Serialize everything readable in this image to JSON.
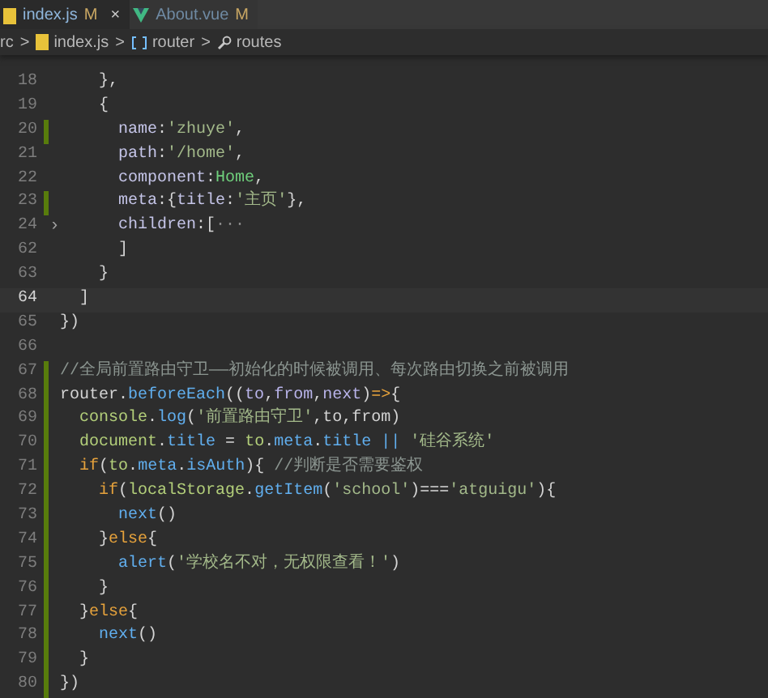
{
  "tabs": [
    {
      "kind": "js",
      "label": "index.js",
      "status": "M",
      "close": "×",
      "selected": true
    },
    {
      "kind": "vue",
      "label": "About.vue",
      "status": "M",
      "selected": false
    }
  ],
  "breadcrumb": [
    {
      "kind": "folder",
      "label": "rc"
    },
    {
      "kind": "js",
      "label": "index.js"
    },
    {
      "kind": "variable",
      "label": "router"
    },
    {
      "kind": "property",
      "label": "routes"
    }
  ],
  "breadcrumb_separator": ">",
  "lines": [
    {
      "n": "18",
      "current": false,
      "modified": false,
      "tokens": [
        {
          "kind": "plain",
          "t": "    },"
        }
      ]
    },
    {
      "n": "19",
      "current": false,
      "modified": false,
      "tokens": [
        {
          "kind": "plain",
          "t": "    {"
        }
      ]
    },
    {
      "n": "20",
      "current": false,
      "modified": true,
      "tokens": [
        {
          "kind": "prop",
          "t": "      name"
        },
        {
          "kind": "plain",
          "t": ":"
        },
        {
          "kind": "string",
          "t": "'zhuye'"
        },
        {
          "kind": "plain",
          "t": ","
        }
      ]
    },
    {
      "n": "21",
      "current": false,
      "modified": false,
      "tokens": [
        {
          "kind": "prop",
          "t": "      path"
        },
        {
          "kind": "plain",
          "t": ":"
        },
        {
          "kind": "string",
          "t": "'/home'"
        },
        {
          "kind": "plain",
          "t": ","
        }
      ]
    },
    {
      "n": "22",
      "current": false,
      "modified": false,
      "tokens": [
        {
          "kind": "prop",
          "t": "      component"
        },
        {
          "kind": "plain",
          "t": ":"
        },
        {
          "kind": "class",
          "t": "Home"
        },
        {
          "kind": "plain",
          "t": ","
        }
      ]
    },
    {
      "n": "23",
      "current": false,
      "modified": true,
      "tokens": [
        {
          "kind": "prop",
          "t": "      meta"
        },
        {
          "kind": "plain",
          "t": ":{"
        },
        {
          "kind": "prop",
          "t": "title"
        },
        {
          "kind": "plain",
          "t": ":"
        },
        {
          "kind": "string",
          "t": "'主页'"
        },
        {
          "kind": "plain",
          "t": "},"
        }
      ]
    },
    {
      "n": "24",
      "current": false,
      "modified": false,
      "fold": "›",
      "tokens": [
        {
          "kind": "prop",
          "t": "      children"
        },
        {
          "kind": "plain",
          "t": ":["
        },
        {
          "kind": "folded",
          "t": "···"
        }
      ]
    },
    {
      "n": "62",
      "current": false,
      "modified": false,
      "tokens": [
        {
          "kind": "plain",
          "t": "      ]"
        }
      ]
    },
    {
      "n": "63",
      "current": false,
      "modified": false,
      "tokens": [
        {
          "kind": "plain",
          "t": "    }"
        }
      ]
    },
    {
      "n": "64",
      "current": true,
      "modified": false,
      "tokens": [
        {
          "kind": "plain",
          "t": "  ]"
        }
      ]
    },
    {
      "n": "65",
      "current": false,
      "modified": false,
      "tokens": [
        {
          "kind": "plain",
          "t": "})"
        }
      ]
    },
    {
      "n": "66",
      "current": false,
      "modified": false
    },
    {
      "n": "67",
      "current": false,
      "modified": true,
      "tokens": [
        {
          "kind": "comment",
          "t": "//全局前置路由守卫——初始化的时候被调用、每次路由切换之前被调用"
        }
      ]
    },
    {
      "n": "68",
      "current": false,
      "modified": true,
      "tokens": [
        {
          "kind": "plain",
          "t": "router."
        },
        {
          "kind": "func",
          "t": "beforeEach"
        },
        {
          "kind": "plain",
          "t": "(("
        },
        {
          "kind": "param",
          "t": "to"
        },
        {
          "kind": "plain",
          "t": ","
        },
        {
          "kind": "param",
          "t": "from"
        },
        {
          "kind": "plain",
          "t": ","
        },
        {
          "kind": "param",
          "t": "next"
        },
        {
          "kind": "plain",
          "t": ")"
        },
        {
          "kind": "keyword",
          "t": "=>"
        },
        {
          "kind": "plain",
          "t": "{"
        }
      ]
    },
    {
      "n": "69",
      "current": false,
      "modified": true,
      "tokens": [
        {
          "kind": "object",
          "t": "  console"
        },
        {
          "kind": "plain",
          "t": "."
        },
        {
          "kind": "func",
          "t": "log"
        },
        {
          "kind": "plain",
          "t": "("
        },
        {
          "kind": "string",
          "t": "'前置路由守卫'"
        },
        {
          "kind": "plain",
          "t": ",to,from)"
        }
      ]
    },
    {
      "n": "70",
      "current": false,
      "modified": true,
      "tokens": [
        {
          "kind": "object",
          "t": "  document"
        },
        {
          "kind": "plain",
          "t": "."
        },
        {
          "kind": "func",
          "t": "title"
        },
        {
          "kind": "plain",
          "t": " = "
        },
        {
          "kind": "object",
          "t": "to"
        },
        {
          "kind": "plain",
          "t": "."
        },
        {
          "kind": "func",
          "t": "meta"
        },
        {
          "kind": "plain",
          "t": "."
        },
        {
          "kind": "func",
          "t": "title"
        },
        {
          "kind": "func",
          "t": " || "
        },
        {
          "kind": "string",
          "t": "'硅谷系统'"
        }
      ]
    },
    {
      "n": "71",
      "current": false,
      "modified": true,
      "tokens": [
        {
          "kind": "keyword",
          "t": "  if"
        },
        {
          "kind": "plain",
          "t": "("
        },
        {
          "kind": "object",
          "t": "to"
        },
        {
          "kind": "plain",
          "t": "."
        },
        {
          "kind": "func",
          "t": "meta"
        },
        {
          "kind": "plain",
          "t": "."
        },
        {
          "kind": "func",
          "t": "isAuth"
        },
        {
          "kind": "plain",
          "t": "){ "
        },
        {
          "kind": "comment",
          "t": "//判断是否需要鉴权"
        }
      ]
    },
    {
      "n": "72",
      "current": false,
      "modified": true,
      "tokens": [
        {
          "kind": "keyword",
          "t": "    if"
        },
        {
          "kind": "plain",
          "t": "("
        },
        {
          "kind": "object",
          "t": "localStorage"
        },
        {
          "kind": "plain",
          "t": "."
        },
        {
          "kind": "func",
          "t": "getItem"
        },
        {
          "kind": "plain",
          "t": "("
        },
        {
          "kind": "string",
          "t": "'school'"
        },
        {
          "kind": "plain",
          "t": ")==="
        },
        {
          "kind": "string",
          "t": "'atguigu'"
        },
        {
          "kind": "plain",
          "t": "){"
        }
      ]
    },
    {
      "n": "73",
      "current": false,
      "modified": true,
      "tokens": [
        {
          "kind": "func",
          "t": "      next"
        },
        {
          "kind": "plain",
          "t": "()"
        }
      ]
    },
    {
      "n": "74",
      "current": false,
      "modified": true,
      "tokens": [
        {
          "kind": "plain",
          "t": "    }"
        },
        {
          "kind": "keyword",
          "t": "else"
        },
        {
          "kind": "plain",
          "t": "{"
        }
      ]
    },
    {
      "n": "75",
      "current": false,
      "modified": true,
      "tokens": [
        {
          "kind": "func",
          "t": "      alert"
        },
        {
          "kind": "plain",
          "t": "("
        },
        {
          "kind": "string",
          "t": "'学校名不对，无权限查看！'"
        },
        {
          "kind": "plain",
          "t": ")"
        }
      ]
    },
    {
      "n": "76",
      "current": false,
      "modified": true,
      "tokens": [
        {
          "kind": "plain",
          "t": "    }"
        }
      ]
    },
    {
      "n": "77",
      "current": false,
      "modified": true,
      "tokens": [
        {
          "kind": "plain",
          "t": "  }"
        },
        {
          "kind": "keyword",
          "t": "else"
        },
        {
          "kind": "plain",
          "t": "{"
        }
      ]
    },
    {
      "n": "78",
      "current": false,
      "modified": true,
      "tokens": [
        {
          "kind": "func",
          "t": "    next"
        },
        {
          "kind": "plain",
          "t": "()"
        }
      ]
    },
    {
      "n": "79",
      "current": false,
      "modified": true,
      "tokens": [
        {
          "kind": "plain",
          "t": "  }"
        }
      ]
    },
    {
      "n": "80",
      "current": false,
      "modified": true,
      "tokens": [
        {
          "kind": "plain",
          "t": "})"
        }
      ]
    }
  ]
}
